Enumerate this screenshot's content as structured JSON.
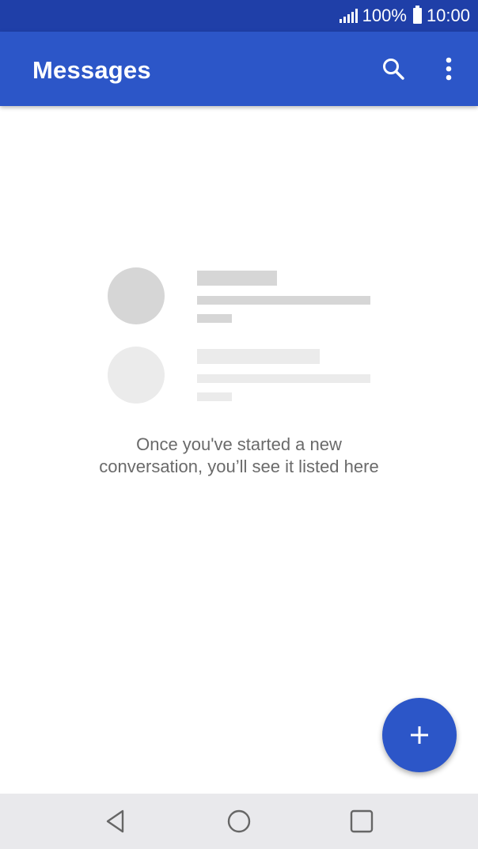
{
  "status_bar": {
    "battery_text": "100%",
    "time": "10:00",
    "icons": [
      "signal-icon",
      "battery-icon"
    ]
  },
  "app_bar": {
    "title": "Messages",
    "actions": [
      "search-icon",
      "more-vert-icon"
    ]
  },
  "empty_state": {
    "line1": "Once you've started a new",
    "line2": "conversation, you’ll see it listed here"
  },
  "fab": {
    "icon": "plus-icon"
  },
  "nav_bar": {
    "buttons": [
      "back-icon",
      "home-icon",
      "recents-icon"
    ]
  },
  "colors": {
    "status_bar": "#1f3fa8",
    "app_bar": "#2c56c8",
    "fab": "#2c56c8",
    "nav_bar": "#e9e9ec",
    "placeholder_dark": "#d6d6d6",
    "placeholder_light": "#ebebeb",
    "message_text": "#6a6a6a"
  }
}
